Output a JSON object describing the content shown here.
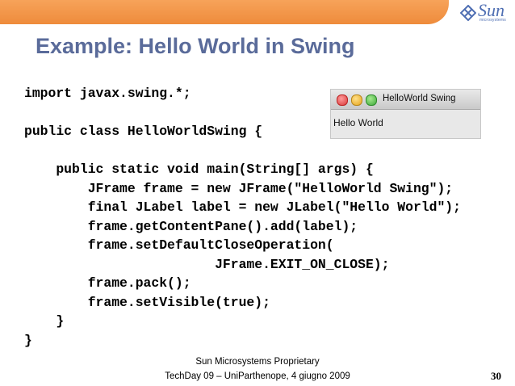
{
  "logo": {
    "word": "Sun",
    "sub": "microsystems"
  },
  "slide": {
    "title": "Example: Hello World in Swing",
    "code_lines": [
      "import javax.swing.*;",
      "",
      "public class HelloWorldSwing {",
      "",
      "    public static void main(String[] args) {",
      "        JFrame frame = new JFrame(\"HelloWorld Swing\");",
      "        final JLabel label = new JLabel(\"Hello World\");",
      "        frame.getContentPane().add(label);",
      "        frame.setDefaultCloseOperation(",
      "                        JFrame.EXIT_ON_CLOSE);",
      "        frame.pack();",
      "        frame.setVisible(true);",
      "    }",
      "}"
    ],
    "window": {
      "title": "HelloWorld Swing",
      "label": "Hello World"
    }
  },
  "footer": {
    "line1": "Sun Microsystems Proprietary",
    "line2": "TechDay 09 – UniParthenope,  4 giugno 2009",
    "page": "30"
  },
  "colors": {
    "band": "#f29a4a",
    "title": "#5a6b9a",
    "logo": "#4f6fb3"
  }
}
